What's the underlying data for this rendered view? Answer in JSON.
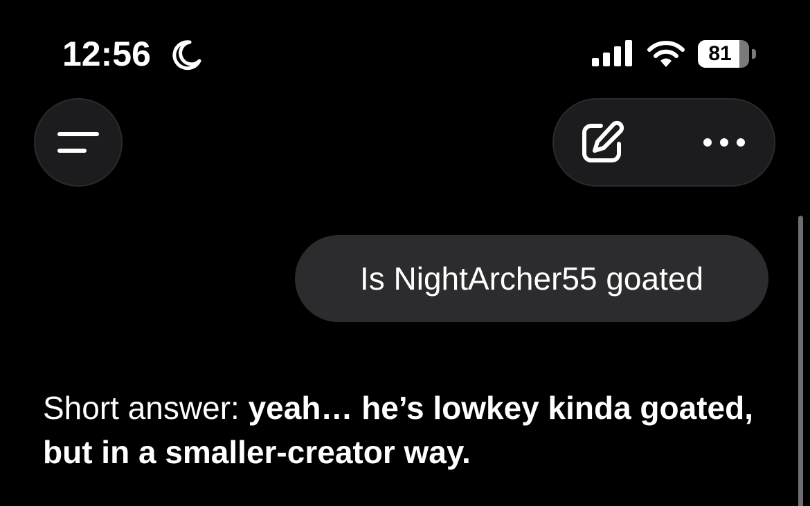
{
  "status_bar": {
    "time": "12:56",
    "focus_icon": "moon-icon",
    "signal_icon": "cellular-signal-icon",
    "wifi_icon": "wifi-icon",
    "battery_level": "81",
    "battery_fraction": 0.81
  },
  "header": {
    "menu_icon": "menu-icon",
    "edit_icon": "new-chat-compose-icon",
    "more_icon": "more-options-icon"
  },
  "conversation": {
    "user_message": "Is NightArcher55 goated",
    "assistant_prefix": "Short answer: ",
    "assistant_bold": "yeah… he’s lowkey kinda goated, but in a smaller-creator way."
  },
  "colors": {
    "background": "#000000",
    "bubble": "#2c2c2e",
    "button": "#1c1c1e",
    "text": "#ffffff"
  }
}
